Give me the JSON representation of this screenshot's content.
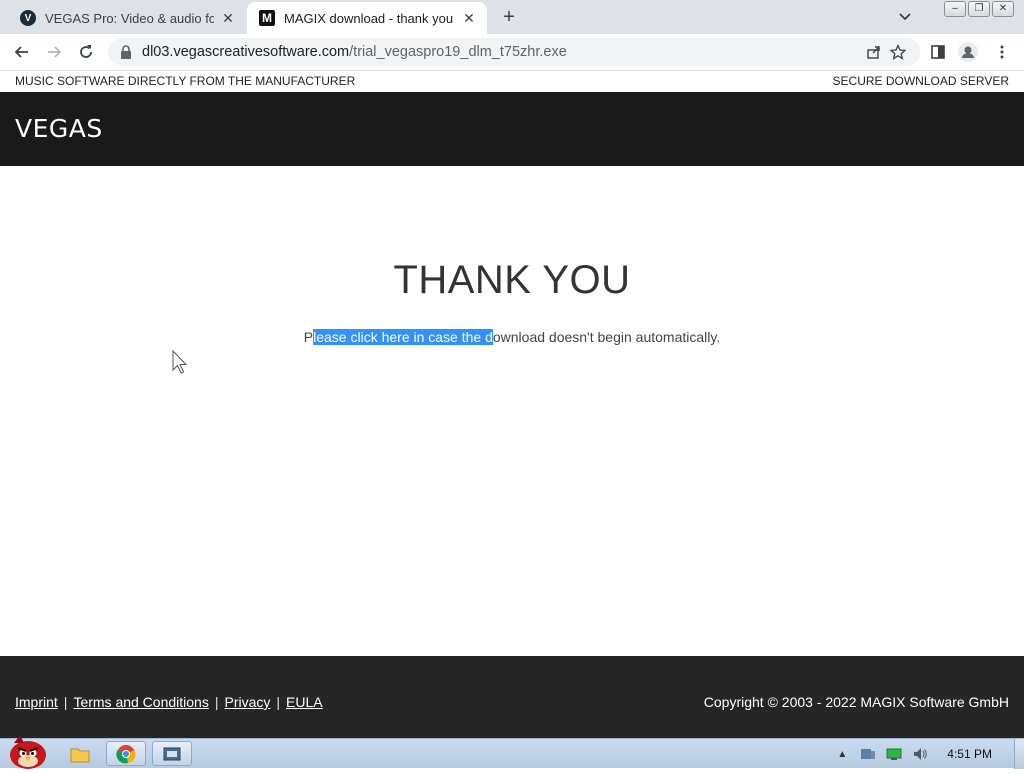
{
  "browser": {
    "tabs": [
      {
        "title": "VEGAS Pro: Video & audio for",
        "favicon": "V"
      },
      {
        "title": "MAGIX download - thank you",
        "favicon": "M"
      }
    ],
    "close_glyph": "✕",
    "new_tab_glyph": "+",
    "url_host": "dl03.vegascreativesoftware.com",
    "url_path": "/trial_vegaspro19_dlm_t75zhr.exe"
  },
  "site": {
    "topbar_left": "MUSIC SOFTWARE DIRECTLY FROM THE MANUFACTURER",
    "topbar_right": "SECURE DOWNLOAD SERVER",
    "logo": "VEGAS",
    "heading": "THANK YOU",
    "message_pre": "P",
    "message_selected": "lease click here in case the d",
    "message_post": "ownload doesn't begin automatically.",
    "footer_links": [
      "Imprint",
      "Terms and Conditions",
      "Privacy",
      "EULA"
    ],
    "footer_sep": "|",
    "copyright": "Copyright © 2003 - 2022 MAGIX Software GmbH"
  },
  "taskbar": {
    "clock": "4:51 PM"
  },
  "colors": {
    "header_bg": "#1a1a1a",
    "footer_bg": "#262626",
    "selection": "#3390ff"
  }
}
